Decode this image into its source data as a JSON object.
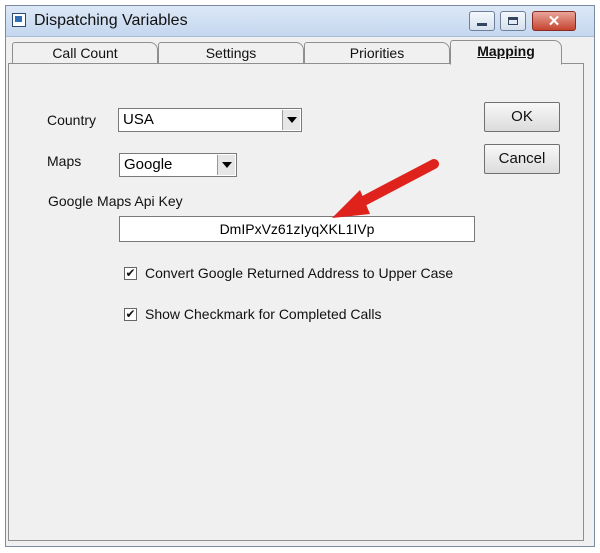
{
  "window": {
    "title": "Dispatching Variables"
  },
  "tabs": [
    {
      "label": "Call Count"
    },
    {
      "label": "Settings"
    },
    {
      "label": "Priorities"
    },
    {
      "label": "Mapping"
    }
  ],
  "form": {
    "country": {
      "label": "Country",
      "value": "USA"
    },
    "maps": {
      "label": "Maps",
      "value": "Google"
    },
    "api_key": {
      "label": "Google Maps Api Key",
      "value": "DmIPxVz61zIyqXKL1IVp"
    },
    "options": [
      {
        "label": "Convert Google Returned Address to Upper Case",
        "checked": true
      },
      {
        "label": "Show Checkmark for Completed Calls",
        "checked": true
      }
    ]
  },
  "buttons": {
    "ok": "OK",
    "cancel": "Cancel"
  },
  "glyphs": {
    "check": "✔",
    "close": "✕"
  },
  "colors": {
    "annotation_arrow": "#e0221c"
  },
  "icons": [
    "app-icon",
    "minimize-icon",
    "maximize-icon",
    "close-icon",
    "dropdown-arrow-icon",
    "checkmark-icon",
    "annotation-arrow"
  ]
}
